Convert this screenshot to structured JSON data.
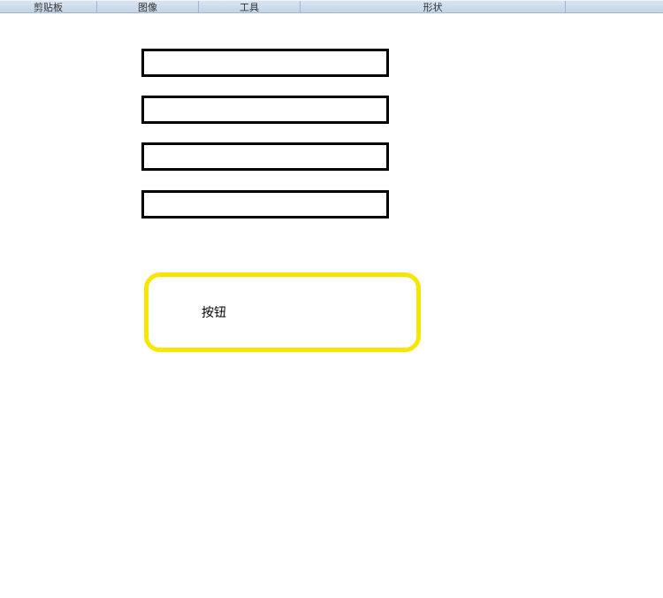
{
  "ribbon": {
    "clipboard": "剪贴板",
    "image": "图像",
    "tools": "工具",
    "shapes": "形状"
  },
  "button": {
    "label": "按钮"
  }
}
